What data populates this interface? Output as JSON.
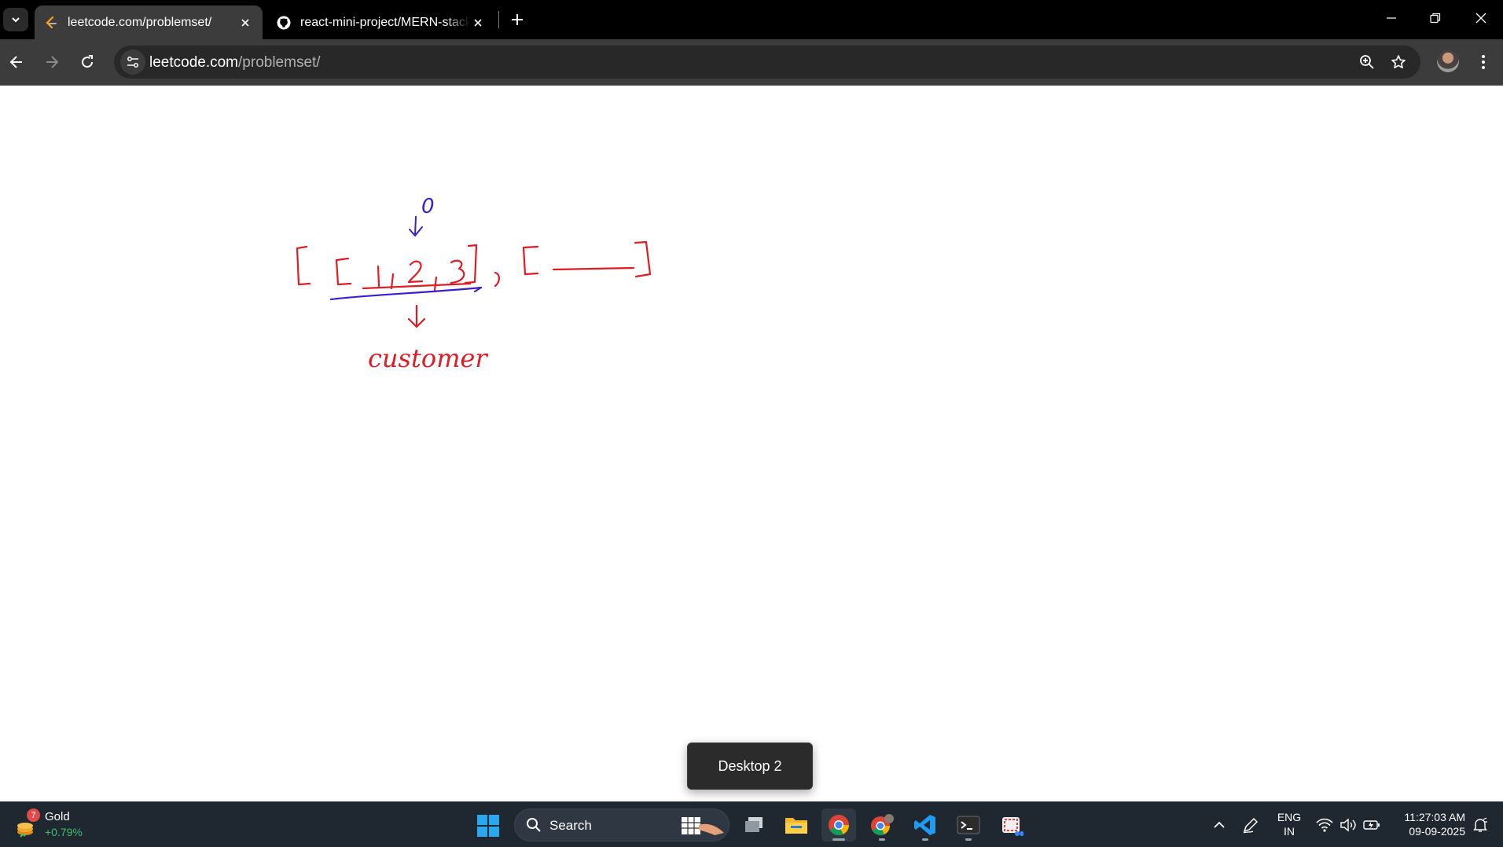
{
  "browser": {
    "tabs": [
      {
        "title": "leetcode.com/problemset/",
        "active": true,
        "icon": "leetcode-icon"
      },
      {
        "title": "react-mini-project/MERN-stack",
        "active": false,
        "icon": "github-icon"
      }
    ],
    "address_bar": {
      "host": "leetcode.com",
      "path": "/problemset/"
    }
  },
  "sketch": {
    "annotation_top": "0",
    "annotation_bottom": "customer",
    "ink_colors": {
      "red": "#e01b24",
      "blue": "#3b1fcf"
    }
  },
  "toast": {
    "label": "Desktop 2"
  },
  "taskbar": {
    "widget": {
      "badge": "7",
      "title": "Gold",
      "change": "+0.79%"
    },
    "search": {
      "label": "Search"
    },
    "apps": [
      "task-view-icon",
      "file-explorer-icon",
      "chrome-icon",
      "chrome-profile-icon",
      "vscode-icon",
      "terminal-icon",
      "snipping-tool-icon"
    ],
    "tray": {
      "lang_line1": "ENG",
      "lang_line2": "IN",
      "time": "11:27:03 AM",
      "date": "09-09-2025"
    }
  },
  "colors": {
    "tabstrip_bg": "#000000",
    "toolbar_bg": "#3c3c3c",
    "taskbar_bg": "#1f2730",
    "positive_change": "#3fc06a"
  }
}
